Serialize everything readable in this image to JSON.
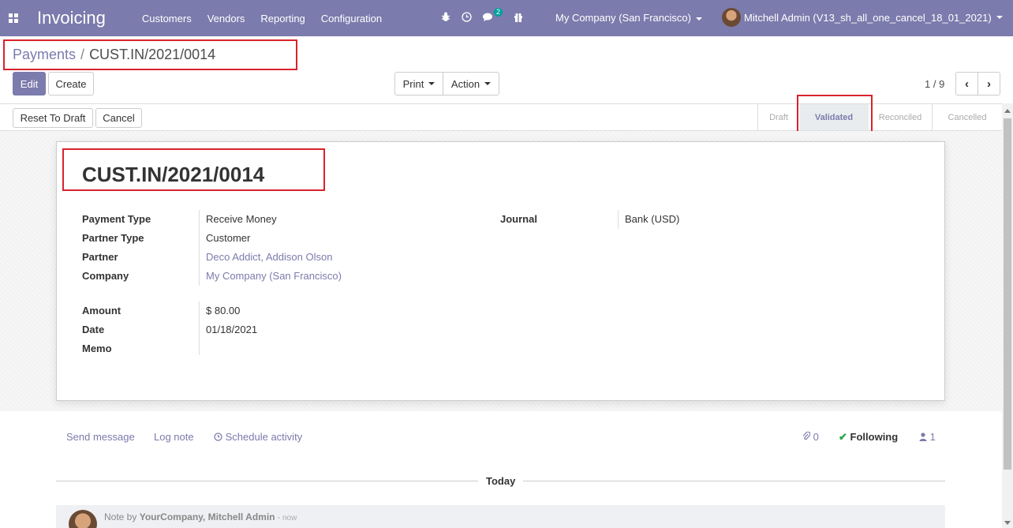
{
  "navbar": {
    "app_name": "Invoicing",
    "menu": [
      "Customers",
      "Vendors",
      "Reporting",
      "Configuration"
    ],
    "icons": [
      "bug-icon",
      "clock-icon",
      "chat-icon",
      "gift-icon"
    ],
    "chat_badge": "2",
    "company": "My Company (San Francisco)",
    "user": "Mitchell Admin (V13_sh_all_one_cancel_18_01_2021)"
  },
  "breadcrumb": {
    "parent": "Payments",
    "separator": "/",
    "current": "CUST.IN/2021/0014"
  },
  "buttons": {
    "edit": "Edit",
    "create": "Create",
    "print": "Print",
    "action": "Action",
    "reset_to_draft": "Reset To Draft",
    "cancel": "Cancel"
  },
  "pager": {
    "value": "1 / 9"
  },
  "statusbar": {
    "stages": [
      "Draft",
      "Validated",
      "Reconciled",
      "Cancelled"
    ],
    "active": "Validated"
  },
  "record": {
    "name": "CUST.IN/2021/0014",
    "fields_left": [
      {
        "label": "Payment Type",
        "value": "Receive Money"
      },
      {
        "label": "Partner Type",
        "value": "Customer"
      },
      {
        "label": "Partner",
        "value": "Deco Addict, Addison Olson"
      },
      {
        "label": "Company",
        "value": "My Company (San Francisco)"
      }
    ],
    "fields_left2": [
      {
        "label": "Amount",
        "value": "$ 80.00"
      },
      {
        "label": "Date",
        "value": "01/18/2021"
      },
      {
        "label": "Memo",
        "value": ""
      }
    ],
    "journal": {
      "label": "Journal",
      "value": "Bank (USD)"
    }
  },
  "chatter": {
    "send_message": "Send message",
    "log_note": "Log note",
    "schedule_activity": "Schedule activity",
    "attachments_count": "0",
    "following": "Following",
    "followers_count": "1",
    "day": "Today",
    "message": {
      "prefix": "Note by",
      "author": "YourCompany, Mitchell Admin",
      "time": "- now"
    }
  },
  "colors": {
    "brand": "#7c7bad",
    "highlight": "#d9232d"
  }
}
